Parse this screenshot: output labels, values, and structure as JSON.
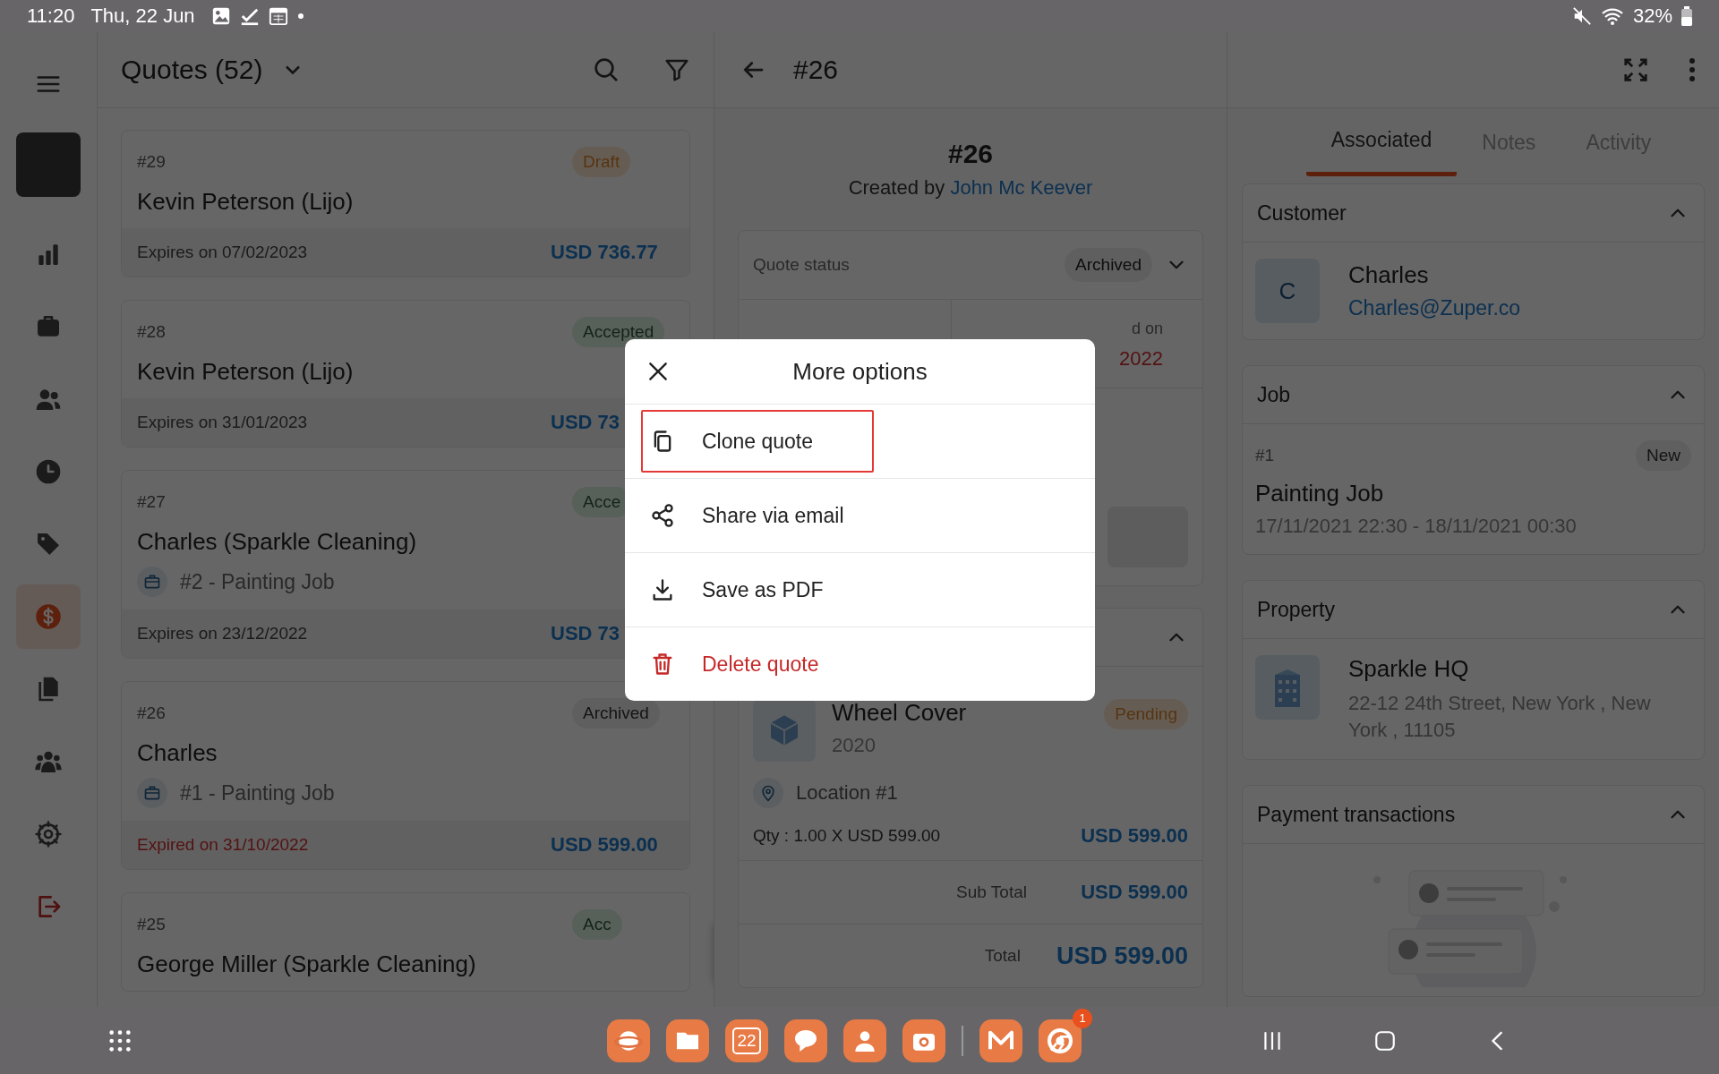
{
  "status_bar": {
    "time": "11:20",
    "date": "Thu, 22 Jun",
    "battery": "32%"
  },
  "nav": [
    {
      "kind": "chart",
      "selected": false
    },
    {
      "kind": "briefcase",
      "selected": false
    },
    {
      "kind": "people",
      "selected": false
    },
    {
      "kind": "clock",
      "selected": false
    },
    {
      "kind": "tag",
      "selected": false
    },
    {
      "kind": "dollar",
      "selected": true
    },
    {
      "kind": "documents",
      "selected": false
    },
    {
      "kind": "group",
      "selected": false
    },
    {
      "kind": "gear",
      "selected": false
    },
    {
      "kind": "logout",
      "selected": false
    }
  ],
  "list": {
    "title": "Quotes (52)",
    "cards": [
      {
        "number": "#29",
        "badge": "Draft",
        "kind": "draft",
        "name": "Kevin Peterson (Lijo)",
        "expiry": "Expires on 07/02/2023",
        "expired": false,
        "amount": "USD 736.77"
      },
      {
        "number": "#28",
        "badge": "Accepted",
        "kind": "accepted",
        "name": "Kevin Peterson (Lijo)",
        "expiry": "Expires on 31/01/2023",
        "expired": false,
        "amount": "USD 73"
      },
      {
        "number": "#27",
        "badge": "Acce",
        "kind": "accepted",
        "name": "Charles (Sparkle Cleaning)",
        "job": "#2 - Painting Job",
        "expiry": "Expires on 23/12/2022",
        "expired": false,
        "amount": "USD 73"
      },
      {
        "number": "#26",
        "badge": "Archived",
        "kind": "archived",
        "name": "Charles",
        "job": "#1 - Painting Job",
        "expiry": "Expired on 31/10/2022",
        "expired": true,
        "amount": "USD 599.00"
      },
      {
        "number": "#25",
        "badge": "Acc",
        "kind": "accepted",
        "name": "George Miller (Sparkle Cleaning)"
      }
    ]
  },
  "detail": {
    "title": "#26",
    "heading": "#26",
    "created_by_label": "Created by",
    "created_by": "John Mc Keever",
    "status_label": "Quote status",
    "status": "Archived",
    "date_label": "d on",
    "date_value": "2022",
    "item": {
      "name": "Wheel Cover",
      "year": "2020",
      "badge": "Pending",
      "location": "Location #1",
      "qty": "Qty : 1.00 X USD 599.00",
      "amount": "USD 599.00"
    },
    "subtotal_label": "Sub Total",
    "subtotal": "USD 599.00",
    "total_label": "Total",
    "total": "USD 599.00"
  },
  "right": {
    "tabs": [
      {
        "label": "Associated",
        "selected": true
      },
      {
        "label": "Notes",
        "selected": false
      },
      {
        "label": "Activity",
        "selected": false
      }
    ],
    "sections": [
      {
        "kind": "customer",
        "title": "Customer",
        "expanded": true,
        "initial": "C",
        "name": "Charles",
        "email": "Charles@Zuper.co"
      },
      {
        "kind": "job",
        "title": "Job",
        "expanded": true,
        "number": "#1",
        "badge": "New",
        "name": "Painting Job",
        "time": "17/11/2021 22:30 - 18/11/2021 00:30"
      },
      {
        "kind": "property",
        "title": "Property",
        "expanded": true,
        "name": "Sparkle HQ",
        "address": "22-12 24th Street, New York , New York , 11105"
      },
      {
        "kind": "payments",
        "title": "Payment transactions",
        "expanded": true
      }
    ]
  },
  "dialog": {
    "title": "More options",
    "items": [
      {
        "kind": "clone",
        "label": "Clone quote",
        "highlighted": true
      },
      {
        "kind": "share",
        "label": "Share via email",
        "highlighted": false
      },
      {
        "kind": "download",
        "label": "Save as PDF",
        "highlighted": false
      },
      {
        "kind": "delete",
        "label": "Delete quote",
        "highlighted": false
      }
    ]
  },
  "dock": [
    {
      "kind": "browser"
    },
    {
      "kind": "files"
    },
    {
      "kind": "calendar",
      "label": "22"
    },
    {
      "kind": "chat"
    },
    {
      "kind": "contacts"
    },
    {
      "kind": "camera"
    },
    {
      "kind": "divider"
    },
    {
      "kind": "mail"
    },
    {
      "kind": "chrome",
      "badge": "1"
    }
  ]
}
